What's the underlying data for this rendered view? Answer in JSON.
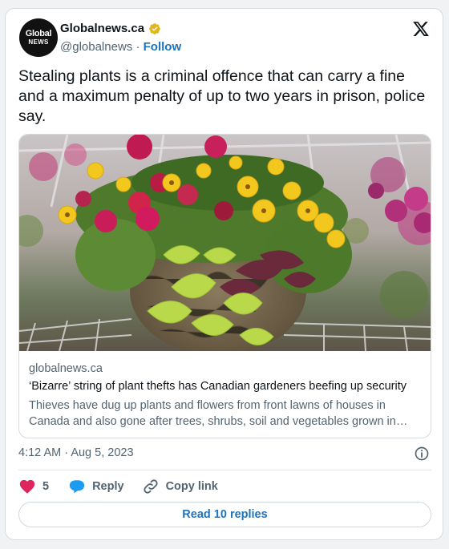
{
  "author": {
    "avatar_line1": "Global",
    "avatar_line2": "NEWS",
    "name": "Globalnews.ca",
    "handle": "@globalnews",
    "separator": "·",
    "follow_label": "Follow",
    "verified_icon": "verified-badge-icon",
    "verified_color": "#e2b719"
  },
  "tweet": {
    "text": "Stealing plants is a criminal offence that can carry a fine and a maximum penalty of up to two years in prison, police say."
  },
  "link_card": {
    "domain": "globalnews.ca",
    "title": "‘Bizarre’ string of plant thefts has Canadian gardeners beefing up security",
    "description": "Thieves have dug up plants and flowers from front lawns of houses in Canada and also gone after trees, shrubs, soil and vegetables grown in gardens."
  },
  "meta": {
    "time": "4:12 AM",
    "separator": "·",
    "date": "Aug 5, 2023"
  },
  "actions": {
    "like_count": "5",
    "reply_label": "Reply",
    "copy_link_label": "Copy link",
    "read_replies_label": "Read 10 replies"
  },
  "colors": {
    "like": "#e0245e",
    "reply": "#1d9bf0",
    "link": "#1d74bd"
  }
}
